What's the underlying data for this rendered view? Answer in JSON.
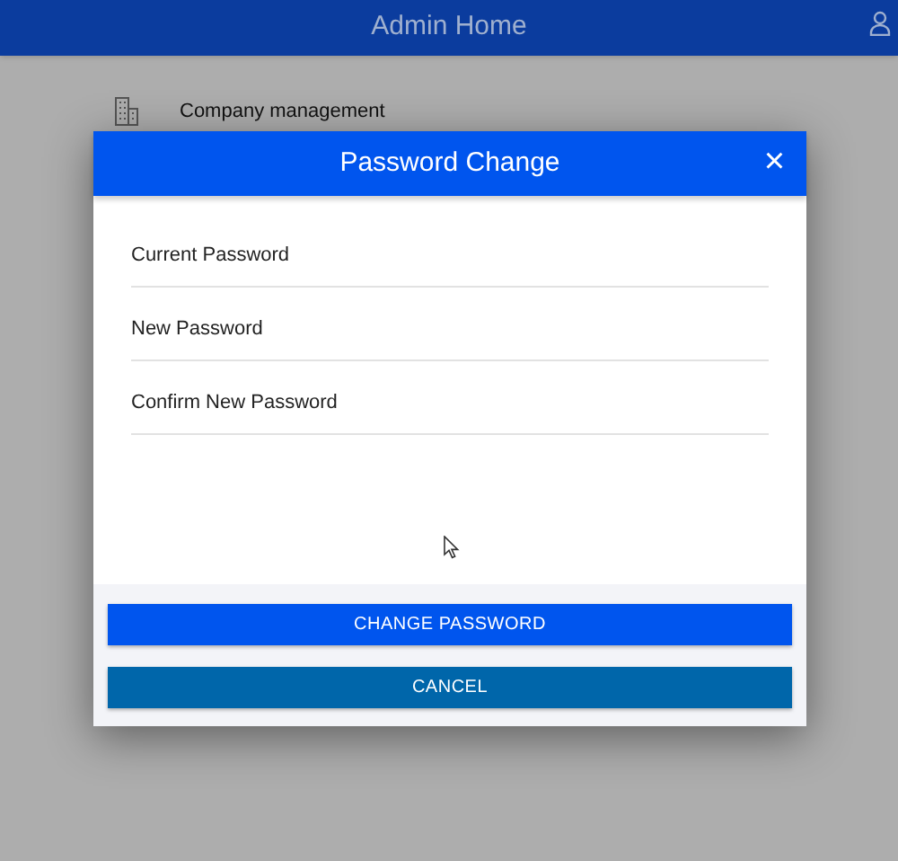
{
  "app_bar": {
    "title": "Admin Home"
  },
  "menu": [
    {
      "label": "Company management"
    }
  ],
  "dialog": {
    "title": "Password Change",
    "close": "×",
    "fields": [
      {
        "placeholder": "Current Password"
      },
      {
        "placeholder": "New Password"
      },
      {
        "placeholder": "Confirm New Password"
      }
    ],
    "buttons": [
      {
        "label": "CHANGE PASSWORD",
        "kind": "primary"
      },
      {
        "label": "CANCEL",
        "kind": "secondary"
      }
    ]
  }
}
